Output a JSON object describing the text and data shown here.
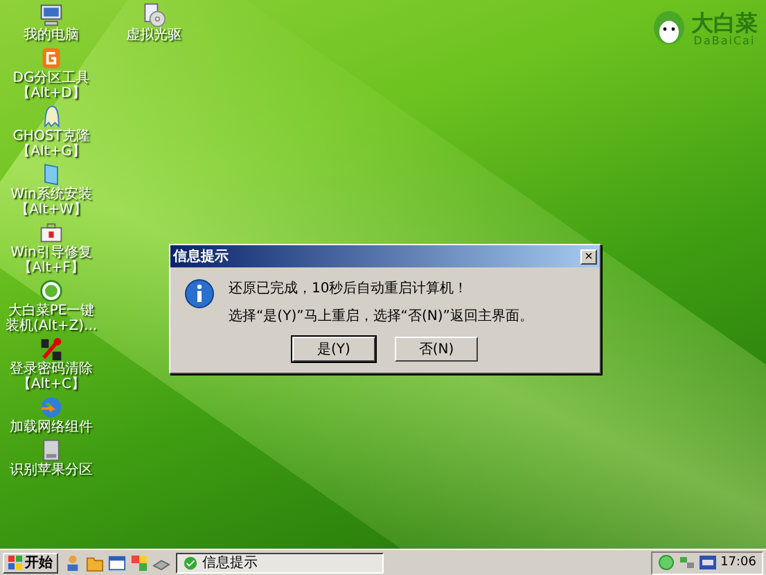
{
  "desktop": {
    "icon_rows": [
      [
        {
          "kind": "computer",
          "lines": [
            "我的电脑"
          ]
        },
        {
          "kind": "cdrom",
          "lines": [
            "虚拟光驱"
          ]
        }
      ],
      [
        {
          "kind": "dg",
          "lines": [
            "DG分区工具",
            "【Alt+D】"
          ]
        }
      ],
      [
        {
          "kind": "ghost",
          "lines": [
            "GHOST克隆",
            "【Alt+G】"
          ]
        }
      ],
      [
        {
          "kind": "win-install",
          "lines": [
            "Win系统安装",
            "【Alt+W】"
          ]
        }
      ],
      [
        {
          "kind": "win-repair",
          "lines": [
            "Win引导修复",
            "【Alt+F】"
          ]
        }
      ],
      [
        {
          "kind": "dabaicai",
          "lines": [
            "大白菜PE一键",
            "装机(Alt+Z)..."
          ]
        }
      ],
      [
        {
          "kind": "password",
          "lines": [
            "登录密码清除",
            "【Alt+C】"
          ]
        }
      ],
      [
        {
          "kind": "network",
          "lines": [
            "加载网络组件"
          ]
        }
      ],
      [
        {
          "kind": "disk",
          "lines": [
            "识别苹果分区"
          ]
        }
      ]
    ]
  },
  "logo": {
    "name": "大白菜",
    "subtitle": "DaBaiCai"
  },
  "dialog": {
    "title": "信息提示",
    "close": "×",
    "lines": [
      "还原已完成，10秒后自动重启计算机！",
      "选择“是(Y)”马上重启，选择“否(N)”返回主界面。"
    ],
    "buttons": [
      {
        "label": "是(Y)",
        "selected": true
      },
      {
        "label": "否(N)",
        "selected": false
      }
    ]
  },
  "taskbar": {
    "start": "开始",
    "tasks": [
      {
        "label": "信息提示",
        "selected": true
      }
    ],
    "clock": "17:06"
  }
}
